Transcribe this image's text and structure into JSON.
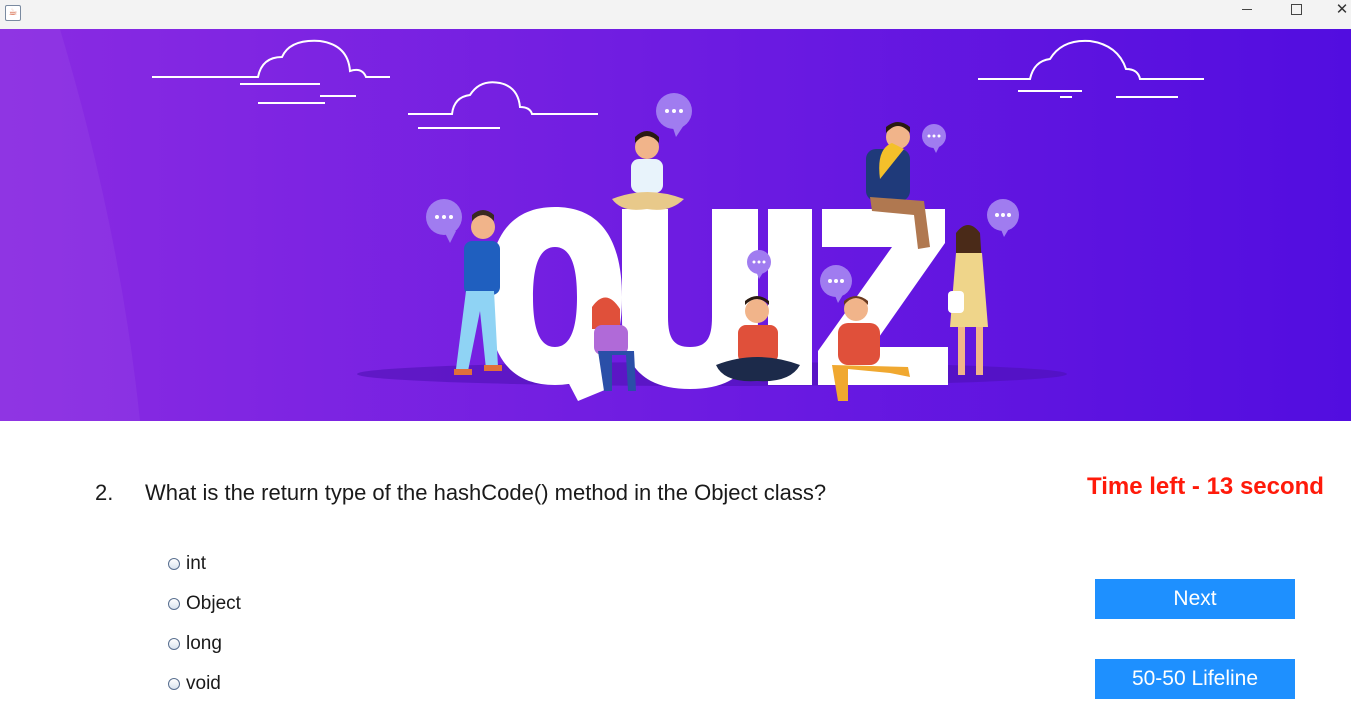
{
  "window": {
    "icon": "java-icon",
    "controls": {
      "minimize": "minimize-icon",
      "maximize": "maximize-icon",
      "close": "close-icon"
    }
  },
  "banner": {
    "title": "QUIZ",
    "colors": {
      "start": "#7d2ae8",
      "end": "#4f0ddf",
      "text": "#ffffff"
    }
  },
  "question": {
    "number": "2.",
    "text": "What is the return type of the hashCode() method in the Object class?"
  },
  "timer": {
    "text": "Time left - 13 second",
    "color": "#ff1a0a"
  },
  "options": [
    {
      "label": "int",
      "selected": false
    },
    {
      "label": "Object",
      "selected": false
    },
    {
      "label": "long",
      "selected": false
    },
    {
      "label": "void",
      "selected": false
    }
  ],
  "buttons": {
    "next": "Next",
    "lifeline": "50-50 Lifeline",
    "color": "#1e90ff"
  }
}
